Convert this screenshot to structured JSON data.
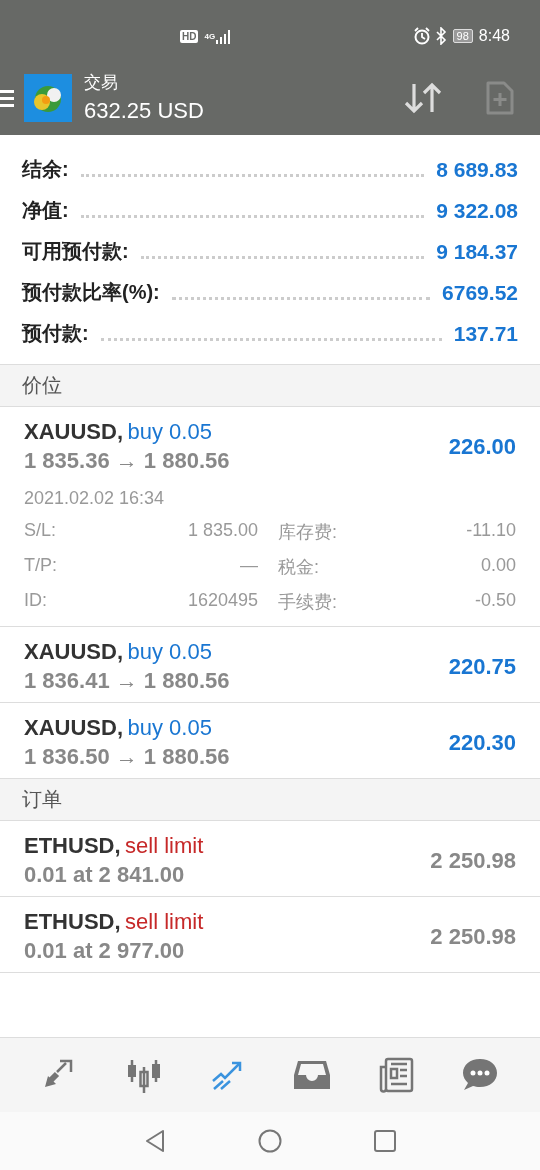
{
  "status_bar": {
    "hd": "HD",
    "network": "4G",
    "battery": "98",
    "time": "8:48"
  },
  "header": {
    "title": "交易",
    "balance": "632.25 USD"
  },
  "summary": [
    {
      "label": "结余:",
      "value": "8 689.83"
    },
    {
      "label": "净值:",
      "value": "9 322.08"
    },
    {
      "label": "可用预付款:",
      "value": "9 184.37"
    },
    {
      "label": "预付款比率(%):",
      "value": "6769.52"
    },
    {
      "label": "预付款:",
      "value": "137.71"
    }
  ],
  "positions_section": {
    "title": "价位",
    "positions": [
      {
        "symbol": "XAUUSD,",
        "kind": "buy",
        "type": "buy 0.05",
        "prices": "1 835.36 → 1 880.56",
        "profit": "226.00",
        "expanded": true,
        "time": "2021.02.02 16:34",
        "details": [
          {
            "label": "S/L:",
            "value": "1 835.00",
            "label2": "库存费:",
            "value2": "-11.10"
          },
          {
            "label": "T/P:",
            "value": "—",
            "label2": "税金:",
            "value2": "0.00"
          },
          {
            "label": "ID:",
            "value": "1620495",
            "label2": "手续费:",
            "value2": "-0.50"
          }
        ]
      },
      {
        "symbol": "XAUUSD,",
        "kind": "buy",
        "type": "buy 0.05",
        "prices": "1 836.41 → 1 880.56",
        "profit": "220.75",
        "expanded": false
      },
      {
        "symbol": "XAUUSD,",
        "kind": "buy",
        "type": "buy 0.05",
        "prices": "1 836.50 → 1 880.56",
        "profit": "220.30",
        "expanded": false
      }
    ]
  },
  "orders_section": {
    "title": "订单",
    "orders": [
      {
        "symbol": "ETHUSD,",
        "kind": "sell",
        "type": "sell limit",
        "detail": "0.01 at 2 841.00",
        "price": "2 250.98"
      },
      {
        "symbol": "ETHUSD,",
        "kind": "sell",
        "type": "sell limit",
        "detail": "0.01 at 2 977.00",
        "price": "2 250.98"
      }
    ]
  },
  "bottom_nav": [
    {
      "selected": false
    },
    {
      "selected": false
    },
    {
      "selected": true
    },
    {
      "selected": false
    },
    {
      "selected": false
    },
    {
      "selected": false
    }
  ]
}
